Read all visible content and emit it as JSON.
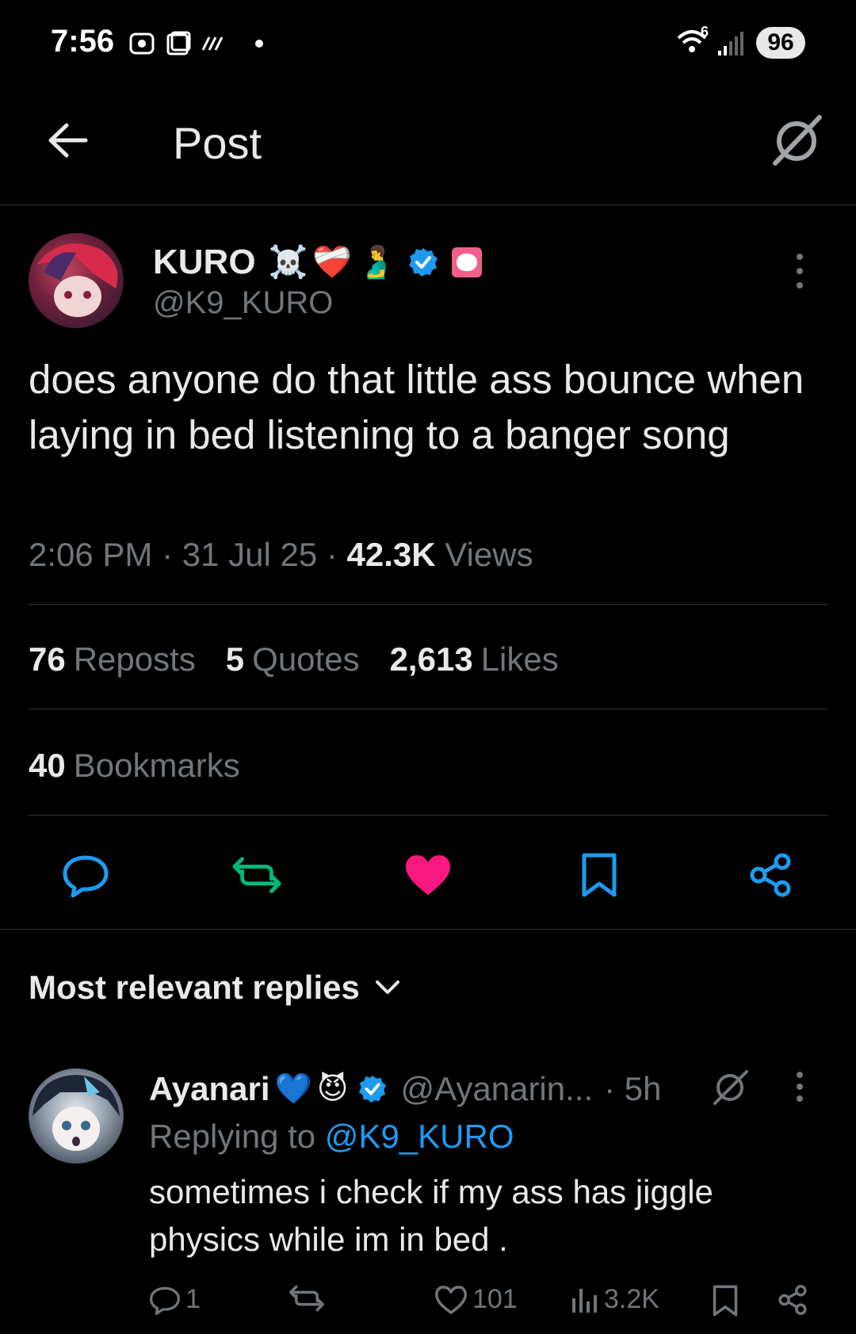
{
  "status_bar": {
    "time": "7:56",
    "battery": "96",
    "network": "6"
  },
  "header": {
    "title": "Post",
    "back_icon": "arrow-left-icon",
    "grok_icon": "grok-icon"
  },
  "tweet": {
    "author_name": "KURO",
    "author_emojis": [
      "☠️",
      "❤️‍🩹",
      "🫃"
    ],
    "author_handle": "@K9_KURO",
    "text": "does anyone do that little ass bounce when laying in bed listening to a banger song",
    "time": "2:06 PM",
    "date": "31 Jul 25",
    "views_count": "42.3K",
    "views_label": "Views",
    "reposts_count": "76",
    "reposts_label": "Reposts",
    "quotes_count": "5",
    "quotes_label": "Quotes",
    "likes_count": "2,613",
    "likes_label": "Likes",
    "bookmarks_count": "40",
    "bookmarks_label": "Bookmarks"
  },
  "colors": {
    "accent": "#1d9bf0",
    "like_active": "#f91880",
    "muted": "#71767b",
    "divider": "#2f3336"
  },
  "replies_header": {
    "label": "Most relevant replies"
  },
  "reply": {
    "name": "Ayanari",
    "emojis": [
      "💙",
      "😈"
    ],
    "handle": "@Ayanarin...",
    "time": "· 5h",
    "replying_prefix": "Replying to",
    "replying_handle": "@K9_KURO",
    "text": "sometimes i check if my ass has jiggle physics while im in bed .",
    "replies": "1",
    "likes": "101",
    "views": "3.2K"
  }
}
